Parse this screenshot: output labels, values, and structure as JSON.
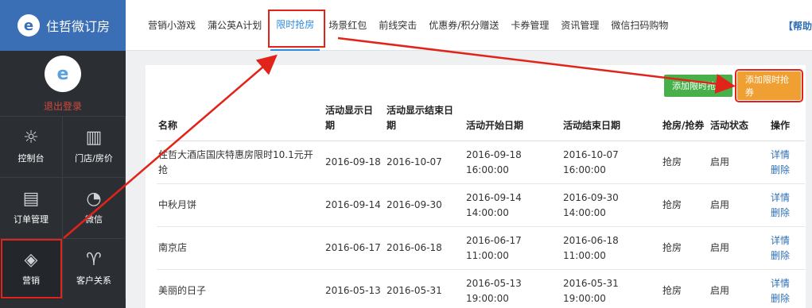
{
  "brand": {
    "logo_char": "e",
    "name": "住哲微订房"
  },
  "profile": {
    "avatar_char": "e",
    "logout_label": "退出登录"
  },
  "sidebar": {
    "items": [
      {
        "label": "控制台",
        "icon": "sun-icon"
      },
      {
        "label": "门店/房价",
        "icon": "building-icon"
      },
      {
        "label": "订单管理",
        "icon": "document-icon"
      },
      {
        "label": "微信",
        "icon": "wechat-icon"
      },
      {
        "label": "营销",
        "icon": "sale-tag-icon",
        "active": true
      },
      {
        "label": "客户关系",
        "icon": "glasses-icon"
      }
    ]
  },
  "topnav": {
    "tabs": [
      {
        "label": "营销小游戏"
      },
      {
        "label": "蒲公英A计划"
      },
      {
        "label": "限时抢房",
        "active": true
      },
      {
        "label": "场景红包"
      },
      {
        "label": "前线突击"
      },
      {
        "label": "优惠券/积分赠送"
      },
      {
        "label": "卡券管理"
      },
      {
        "label": "资讯管理"
      },
      {
        "label": "微信扫码购物"
      }
    ],
    "help_label": "【帮助"
  },
  "actions": {
    "green_button": "添加限时抢房",
    "orange_button": "添加限时抢券"
  },
  "table": {
    "headers": [
      "名称",
      "活动显示日期",
      "活动显示结束日期",
      "活动开始日期",
      "活动结束日期",
      "抢房/抢券",
      "活动状态",
      "操作"
    ],
    "rows": [
      {
        "name": "住哲大酒店国庆特惠房限时10.1元开抢",
        "show_start": "2016-09-18",
        "show_end": "2016-10-07",
        "start": "2016-09-18 16:00:00",
        "end": "2016-10-07 16:00:00",
        "type": "抢房",
        "status": "启用",
        "detail": "详情",
        "delete": "删除"
      },
      {
        "name": "中秋月饼",
        "show_start": "2016-09-14",
        "show_end": "2016-09-30",
        "start": "2016-09-14 14:00:00",
        "end": "2016-09-30 14:00:00",
        "type": "抢房",
        "status": "启用",
        "detail": "详情",
        "delete": "删除"
      },
      {
        "name": "南京店",
        "show_start": "2016-06-17",
        "show_end": "2016-06-18",
        "start": "2016-06-17 11:00:00",
        "end": "2016-06-18 11:00:00",
        "type": "抢房",
        "status": "启用",
        "detail": "详情",
        "delete": "删除"
      },
      {
        "name": "美丽的日子",
        "show_start": "2016-05-13",
        "show_end": "2016-05-31",
        "start": "2016-05-13 19:00:00",
        "end": "2016-05-31 19:00:00",
        "type": "抢房",
        "status": "启用",
        "detail": "详情",
        "delete": "删除"
      }
    ]
  },
  "colors": {
    "sidebar_bg": "#2b2f33",
    "brand_blue": "#3a6eb5",
    "annotation_red": "#e2231a",
    "green": "#48b04a",
    "orange": "#f0a032",
    "link": "#2f6fb5"
  }
}
